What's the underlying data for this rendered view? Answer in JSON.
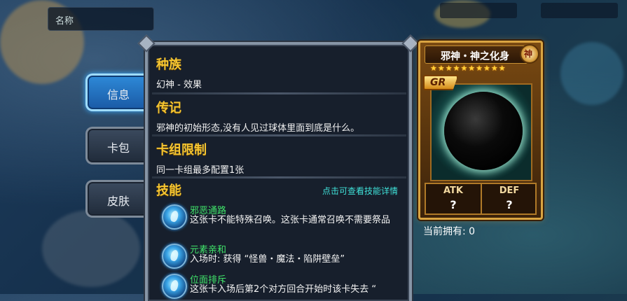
{
  "topbar": {
    "left_text": "名称"
  },
  "tabs": [
    {
      "label": "信息",
      "active": true
    },
    {
      "label": "卡包",
      "active": false
    },
    {
      "label": "皮肤",
      "active": false
    }
  ],
  "panel": {
    "race": {
      "title": "种族",
      "text": "幻神 - 效果"
    },
    "bio": {
      "title": "传记",
      "text": "邪神的初始形态,没有人见过球体里面到底是什么。"
    },
    "deck_limit": {
      "title": "卡组限制",
      "text": "同一卡组最多配置1张"
    },
    "skills": {
      "title": "技能",
      "hint": "点击可查看技能详情",
      "items": [
        {
          "name": "邪恶通路",
          "desc": "这张卡不能特殊召唤。这张卡通常召唤不需要祭品",
          "icon": "water-drop-icon"
        },
        {
          "name": "元素亲和",
          "desc": "入场时: 获得 “怪兽・魔法・陷阱壁垒”",
          "icon": "water-drop-icon"
        },
        {
          "name": "位面排斥",
          "desc": "这张卡入场后第2个对方回合开始时该卡失去 “",
          "icon": "water-drop-icon"
        }
      ]
    }
  },
  "card": {
    "name": "邪神・神之化身",
    "badge": "神",
    "stars": "★★★★★★★★★★",
    "rarity": "GR",
    "atk_label": "ATK",
    "atk_value": "?",
    "def_label": "DEF",
    "def_value": "?"
  },
  "owned": "当前拥有: 0",
  "colors": {
    "accent": "#f5c531",
    "skill_name": "#40e46a",
    "hint": "#3fe0d8"
  }
}
